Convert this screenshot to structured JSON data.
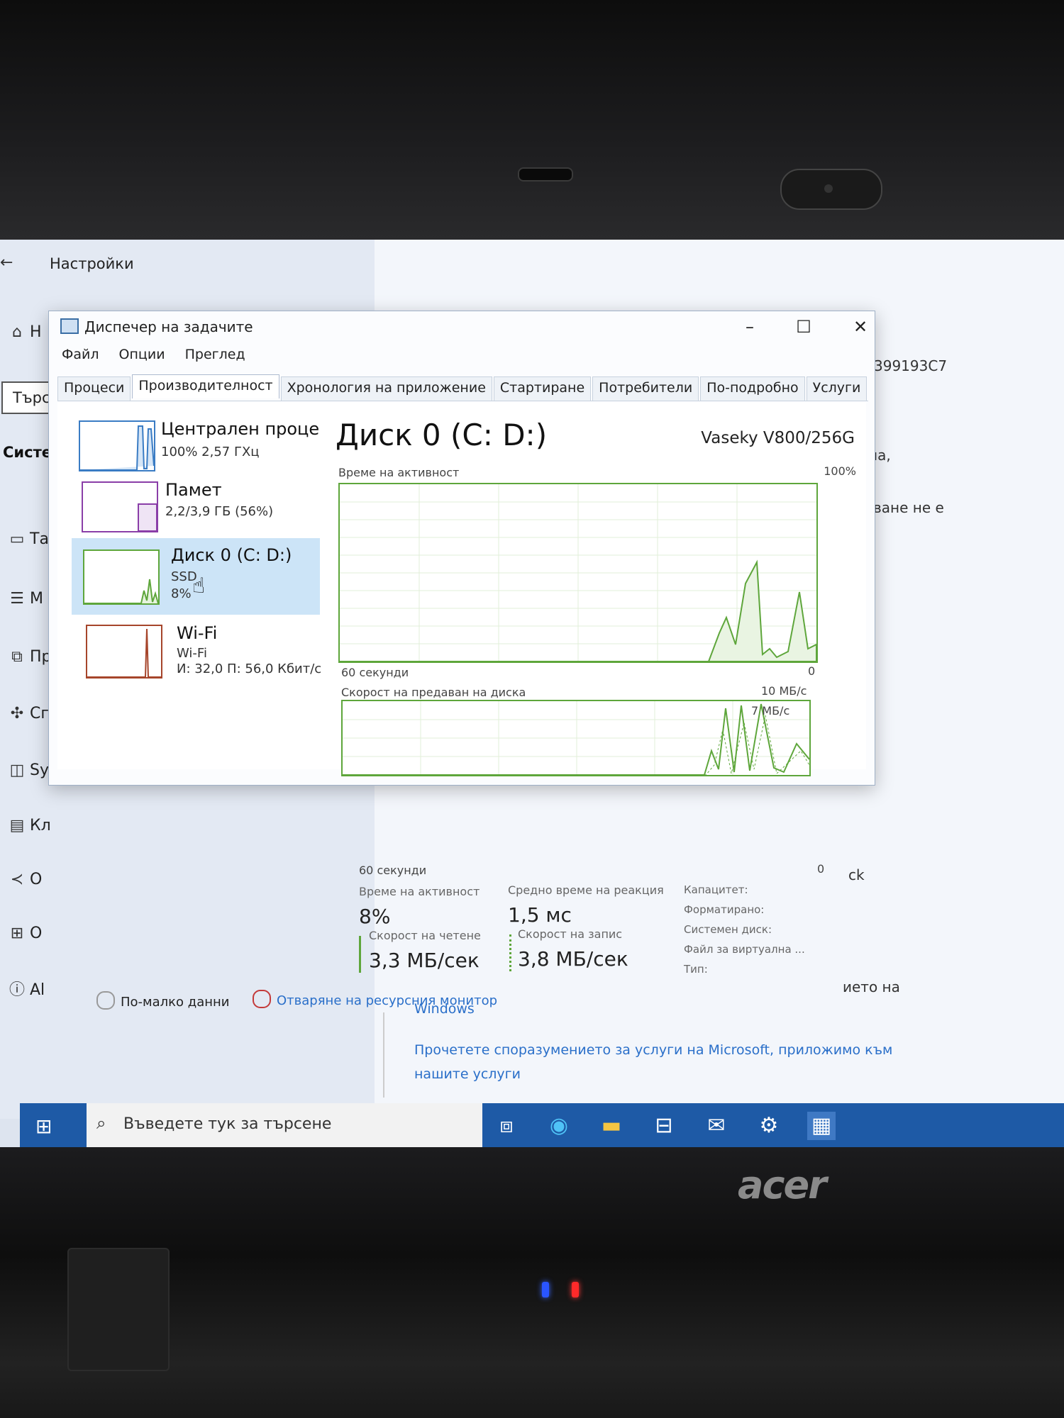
{
  "settings": {
    "title": "Настройки",
    "search_label": "Търс",
    "heading": "Систем",
    "sidebar": [
      {
        "icon": "home-icon",
        "glyph": "⌂",
        "label": "Н"
      },
      {
        "icon": "display-icon",
        "glyph": "▭",
        "label": "Та"
      },
      {
        "icon": "multitask-icon",
        "glyph": "☰",
        "label": "М"
      },
      {
        "icon": "project-icon",
        "glyph": "⧉",
        "label": "Пр"
      },
      {
        "icon": "shared-icon",
        "glyph": "✣",
        "label": "Сг"
      },
      {
        "icon": "clipboard-icon",
        "glyph": "◫",
        "label": "Sy"
      },
      {
        "icon": "clipboard2-icon",
        "glyph": "▤",
        "label": "Кл"
      },
      {
        "icon": "remote-icon",
        "glyph": "≺",
        "label": "О"
      },
      {
        "icon": "apps-icon",
        "glyph": "⊞",
        "label": "О"
      },
      {
        "icon": "info-icon",
        "glyph": "ⓘ",
        "label": "Al"
      }
    ],
    "right_fragments": [
      "399193C7",
      "ма,",
      "сване не е",
      "ck",
      "ието на"
    ],
    "links": [
      "Windows",
      "Прочетете споразумението за услуги на Microsoft, приложимо към",
      "нашите услуги"
    ]
  },
  "taskmanager": {
    "title": "Диспечер на задачите",
    "menu": [
      "Файл",
      "Опции",
      "Преглед"
    ],
    "tabs": [
      "Процеси",
      "Производителност",
      "Хронология на приложение",
      "Стартиране",
      "Потребители",
      "По-подробно",
      "Услуги"
    ],
    "active_tab": "Производителност",
    "resources": [
      {
        "name": "Централен проце",
        "sub1": "100% 2,57 ГХц",
        "sub2": ""
      },
      {
        "name": "Памет",
        "sub1": "2,2/3,9 ГБ (56%)",
        "sub2": ""
      },
      {
        "name": "Диск 0 (C: D:)",
        "sub1": "SSD",
        "sub2": "8%"
      },
      {
        "name": "Wi-Fi",
        "sub1": "Wi-Fi",
        "sub2": "И: 32,0 П: 56,0 Кбит/с"
      }
    ],
    "disk_title": "Диск 0 (C: D:)",
    "disk_model": "Vaseky V800/256G",
    "graph1": {
      "label": "Време на активност",
      "max": "100%",
      "x_left": "60 секунди",
      "x_right": "0"
    },
    "graph2": {
      "label": "Скорост на предаван на диска",
      "max": "10 МБ/с",
      "inner": "7 МБ/с",
      "x_left": "60 секунди",
      "x_right": "0"
    },
    "stats": {
      "active_label": "Време на активност",
      "active_val": "8%",
      "resp_label": "Средно време на реакция",
      "resp_val": "1,5 мс",
      "read_label": "Скорост на четене",
      "read_val": "3,3 МБ/сек",
      "write_label": "Скорост на запис",
      "write_val": "3,8 МБ/сек"
    },
    "properties": [
      "Капацитет:",
      "Форматирано:",
      "Системен диск:",
      "Файл за виртуална ...",
      "Тип:"
    ],
    "footer_less": "По-малко данни",
    "footer_link": "Отваряне на ресурсния монитор"
  },
  "taskbar": {
    "search_placeholder": "Въведете тук за търсене"
  },
  "laptop": {
    "brand": "acer"
  },
  "colors": {
    "disk_graph": "#5ea63b",
    "selected": "#cce4f7",
    "link": "#2a6fc9",
    "taskbar": "#1e5aa6"
  }
}
